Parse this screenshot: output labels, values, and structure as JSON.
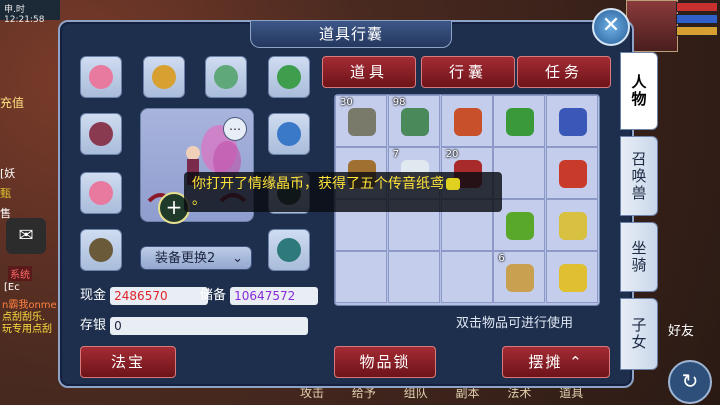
{
  "panel": {
    "title": "道具行囊"
  },
  "hud": {
    "time_label": "12:21:58",
    "left_top": "申.时",
    "recharge": "充值",
    "left_texts": [
      "[妖",
      "甄",
      "售",
      "系统",
      "[Ec",
      "n霸我onme",
      "点刮刮乐.",
      "玩专用点刮"
    ],
    "friend": "好友"
  },
  "equipment": [
    {
      "name": "flower-cloth-icon",
      "color": "#e87aa0"
    },
    {
      "name": "gold-ring-icon",
      "color": "#d8a030"
    },
    {
      "name": "jade-necklace-icon",
      "color": "#5fa87a"
    },
    {
      "name": "green-bracelet-icon",
      "color": "#3e9e4e"
    },
    {
      "name": "fan-weapon-icon",
      "color": "#8a3a50"
    },
    {
      "name": "blue-feather-icon",
      "color": "#3a78c8"
    },
    {
      "name": "pink-flower-icon",
      "color": "#e87aa0"
    },
    {
      "name": "dark-hat-icon",
      "color": "#2a4a3a"
    },
    {
      "name": "waist-belt-icon",
      "color": "#6a5a3a"
    },
    {
      "name": "green-boots-icon",
      "color": "#2e7a7a"
    }
  ],
  "swap_button": "装备更换2",
  "money": {
    "cash_label": "现金",
    "cash_value": "2486570",
    "reserve_label": "储备",
    "reserve_value": "10647572",
    "deposit_label": "存银",
    "deposit_value": "0"
  },
  "tabs": [
    "道具",
    "行囊",
    "任务"
  ],
  "grid_items": [
    {
      "qty": "30",
      "name": "grey-coil-icon",
      "color": "#7a7a6a"
    },
    {
      "qty": "98",
      "name": "green-star-icon",
      "color": "#4a8a5a"
    },
    {
      "qty": "",
      "name": "red-bowl-icon",
      "color": "#c8502a"
    },
    {
      "qty": "",
      "name": "green-flag-icon",
      "color": "#3a9a3a"
    },
    {
      "qty": "",
      "name": "blue-flag-icon",
      "color": "#3a58b8"
    },
    {
      "qty": "",
      "name": "gold-book-icon",
      "color": "#a07030"
    },
    {
      "qty": "7",
      "name": "snowflake-icon",
      "color": "#e0e8f0"
    },
    {
      "qty": "20",
      "name": "red-box-icon",
      "color": "#a82a2a"
    },
    {
      "qty": "",
      "name": "",
      "color": ""
    },
    {
      "qty": "",
      "name": "red-flag-icon",
      "color": "#c83a2a"
    },
    {
      "qty": "",
      "name": "",
      "color": ""
    },
    {
      "qty": "",
      "name": "",
      "color": ""
    },
    {
      "qty": "",
      "name": "",
      "color": ""
    },
    {
      "qty": "",
      "name": "green-flag-icon",
      "color": "#5aa82a"
    },
    {
      "qty": "",
      "name": "yellow-flag-icon",
      "color": "#d8c040"
    },
    {
      "qty": "",
      "name": "",
      "color": ""
    },
    {
      "qty": "",
      "name": "",
      "color": ""
    },
    {
      "qty": "",
      "name": "",
      "color": ""
    },
    {
      "qty": "6",
      "name": "treasure-map-icon",
      "color": "#c8a050"
    },
    {
      "qty": "",
      "name": "yellow-flag-icon",
      "color": "#e0c030"
    }
  ],
  "hint": "双击物品可进行使用",
  "side_tabs": [
    "人物",
    "召唤兽",
    "坐骑",
    "子女"
  ],
  "bottom_buttons": {
    "treasure": "法宝",
    "lock": "物品锁",
    "stall": "摆摊"
  },
  "toast": "你打开了情缘晶币，获得了五个传音纸鸢",
  "background_bottom": [
    "攻击",
    "给予",
    "组队",
    "副本",
    "法术",
    "道具"
  ],
  "colors": {
    "cash": "#e0242a",
    "reserve": "#8a2ad8",
    "accent": "#a42b34"
  }
}
